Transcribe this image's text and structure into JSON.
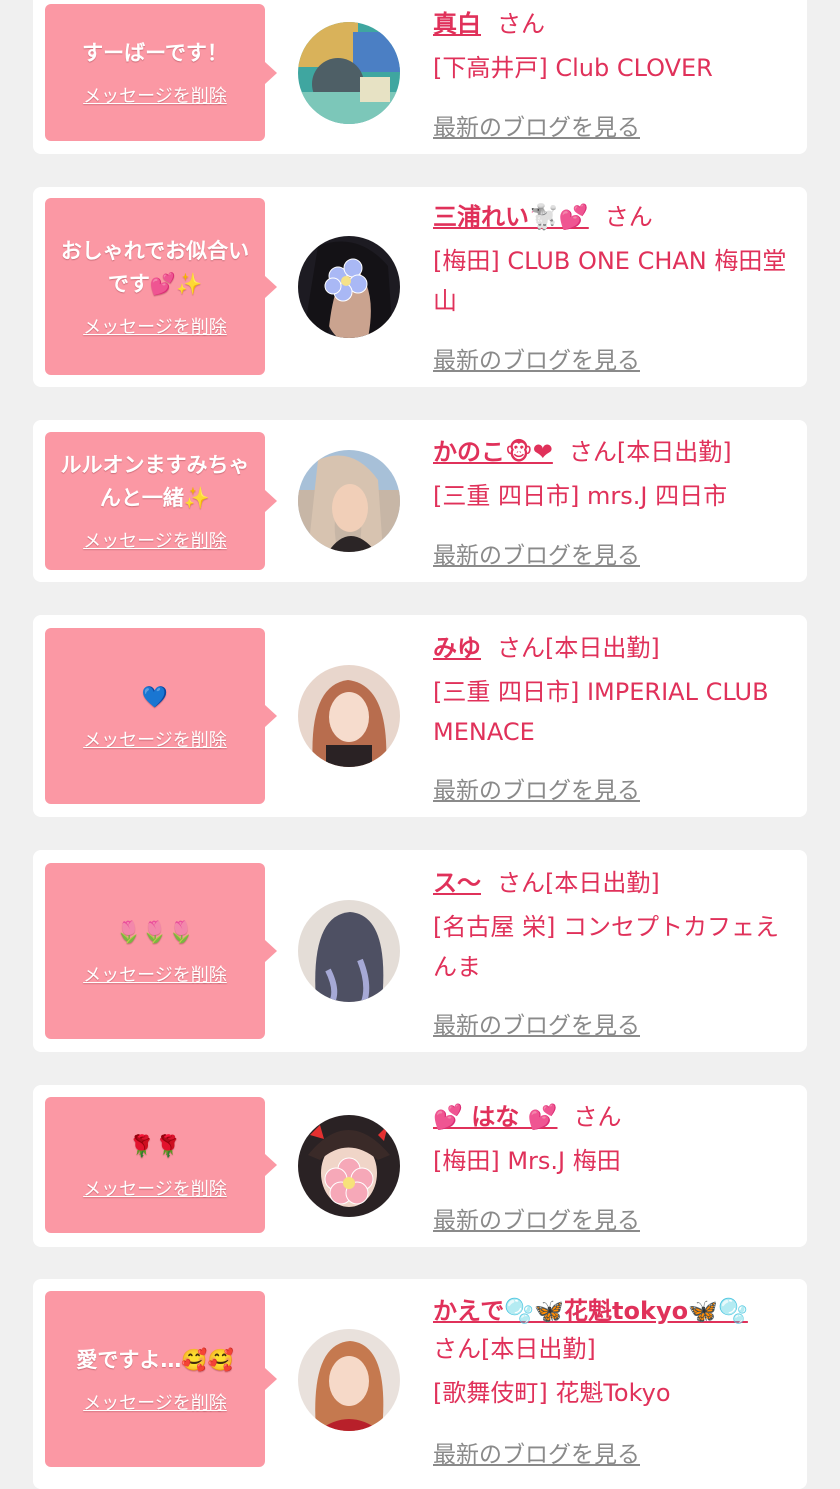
{
  "delete_label": "メッセージを削除",
  "blog_label": "最新のブログを見る",
  "cards": [
    {
      "message": "すーばーです！",
      "name": "真白",
      "suffix": "さん",
      "shop": "[下高井戸] Club CLOVER"
    },
    {
      "message": "おしゃれでお似合いです💕✨",
      "name": "三浦れい🐩💕",
      "suffix": "さん",
      "shop": "[梅田] CLUB ONE CHAN 梅田堂山"
    },
    {
      "message": "ルルオンますみちゃんと一緒✨",
      "name": "かのこ🐵❤",
      "suffix": "さん[本日出勤]",
      "shop": "[三重 四日市] mrs.J 四日市"
    },
    {
      "message": "💙",
      "name": "みゆ",
      "suffix": "さん[本日出勤]",
      "shop": "[三重 四日市] IMPERIAL CLUB MENACE"
    },
    {
      "message": "🌷🌷🌷",
      "name": "ス〜",
      "suffix": "さん[本日出勤]",
      "shop": "[名古屋 栄] コンセプトカフェえんま"
    },
    {
      "message": "🌹🌹",
      "name": "💕 はな 💕",
      "suffix": "さん",
      "shop": "[梅田] Mrs.J 梅田"
    },
    {
      "message": "愛ですよ…🥰🥰",
      "name": "かえで🫧🦋花魁tokyo🦋🫧",
      "suffix": "さん[本日出勤]",
      "shop": "[歌舞伎町] 花魁Tokyo"
    }
  ],
  "colors": {
    "accent": "#e0315a",
    "bubble": "#fb98a4",
    "muted": "#8a8a8a",
    "background": "#f0f0f0"
  }
}
